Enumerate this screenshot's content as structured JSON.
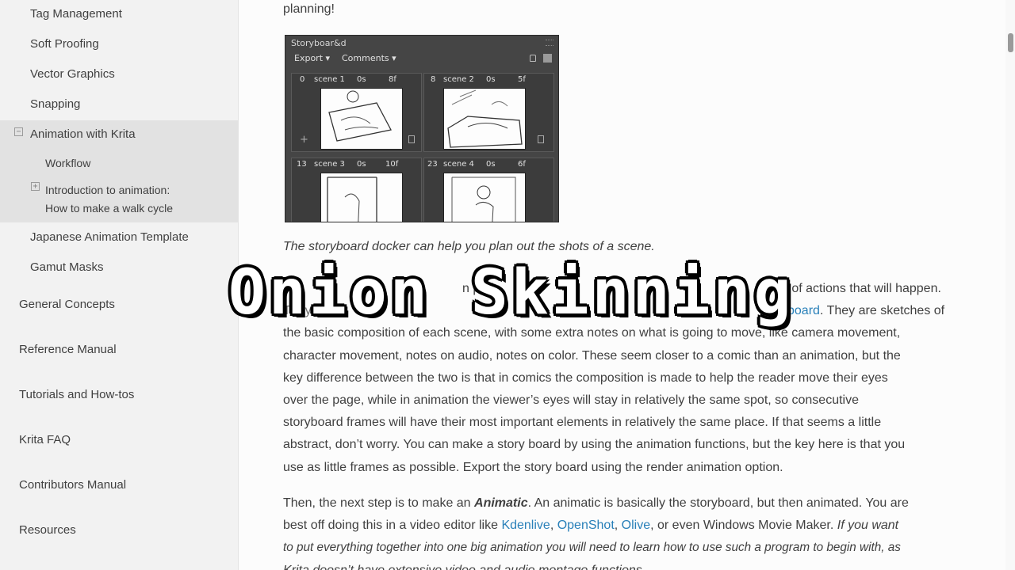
{
  "sidebar": {
    "items_l1_top": [
      {
        "label": "Tag Management"
      },
      {
        "label": "Soft Proofing"
      },
      {
        "label": "Vector Graphics"
      },
      {
        "label": "Snapping"
      }
    ],
    "animation": {
      "label": "Animation with Krita",
      "toggle": "−",
      "workflow": "Workflow",
      "intro_line1": "Introduction to animation:",
      "intro_line2": "How to make a walk cycle",
      "intro_toggle": "+"
    },
    "items_l1_bottom": [
      {
        "label": "Japanese Animation Template"
      },
      {
        "label": "Gamut Masks"
      }
    ],
    "top_level": [
      {
        "label": "General Concepts"
      },
      {
        "label": "Reference Manual"
      },
      {
        "label": "Tutorials and How-tos"
      },
      {
        "label": "Krita FAQ"
      },
      {
        "label": "Contributors Manual"
      },
      {
        "label": "Resources"
      }
    ]
  },
  "main": {
    "top_text": "planning!",
    "docker": {
      "title": "Storyboar&d",
      "menu_export": "Export",
      "menu_comments": "Comments",
      "scenes": [
        {
          "num": "0",
          "name": "scene 1",
          "dur": "0s",
          "frames": "8f"
        },
        {
          "num": "8",
          "name": "scene 2",
          "dur": "0s",
          "frames": "5f"
        },
        {
          "num": "13",
          "name": "scene 3",
          "dur": "0s",
          "frames": "10f"
        },
        {
          "num": "23",
          "name": "scene 4",
          "dur": "0s",
          "frames": "6f"
        }
      ]
    },
    "caption": "The storyboard docker can help you plan out the shots of a scene.",
    "para1": {
      "line1_start": "n proje",
      "line1_end": "e of actions that will happen.",
      "line2_start": "They are",
      "line2_link": "yboard",
      "line2_end": ". They are sketches of",
      "line3": "the basic composition of each scene, with some extra notes on what is going to move, like camera movement,",
      "line4": "character movement, notes on audio, notes on color. These seem closer to a comic than an animation, but the",
      "line5": "key difference between the two is that in comics the composition is made to help the reader move their eyes",
      "line6": "over the page, while in animation the viewer’s eyes will stay in relatively the same spot, so consecutive",
      "line7": "storyboard frames will have their most important elements in relatively the same place. If that seems a little",
      "line8": "abstract, don’t worry. You can make a story board by using the animation functions, but the key here is that you",
      "line9": "use as little frames as possible. Export the story board using the render animation option."
    },
    "para2": {
      "a": "Then, the next step is to make an ",
      "b": "Animatic",
      "c": ". An animatic is basically the storyboard, but then animated. You are",
      "d": "best off doing this in a video editor like ",
      "link1": "Kdenlive",
      "sep1": ", ",
      "link2": "OpenShot",
      "sep2": ", ",
      "link3": "Olive",
      "e": ", or even Windows Movie Maker. ",
      "f": "If you want",
      "g": "to put everything together into one big animation you will need to learn how to use such a program to begin with, as",
      "h": "Krita doesn’t have extensive video and audio montage functions."
    }
  },
  "overlay": {
    "text": "Onion Skinning"
  },
  "colors": {
    "link": "#2980b9",
    "sidebar_bg": "#f2f2f2",
    "sidebar_active": "#e2e2e2"
  }
}
